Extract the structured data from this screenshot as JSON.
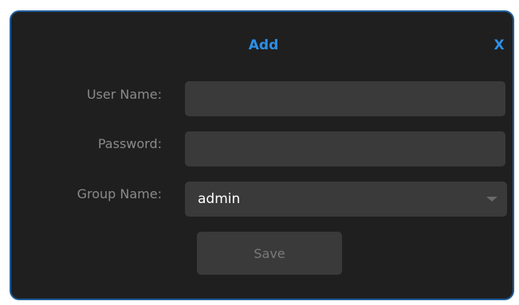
{
  "dialog": {
    "title": "Add",
    "close_label": "X"
  },
  "form": {
    "user_name_label": "User Name:",
    "user_name_value": "",
    "password_label": "Password:",
    "password_value": "",
    "group_name_label": "Group Name:",
    "group_name_selected": "admin",
    "save_label": "Save"
  },
  "colors": {
    "accent": "#2d8fe8",
    "dialog_border": "#1d5d9a",
    "dialog_bg": "#1f1f1f",
    "field_bg": "#3a3a3a"
  },
  "icons": {
    "dropdown": "chevron-down-icon"
  }
}
